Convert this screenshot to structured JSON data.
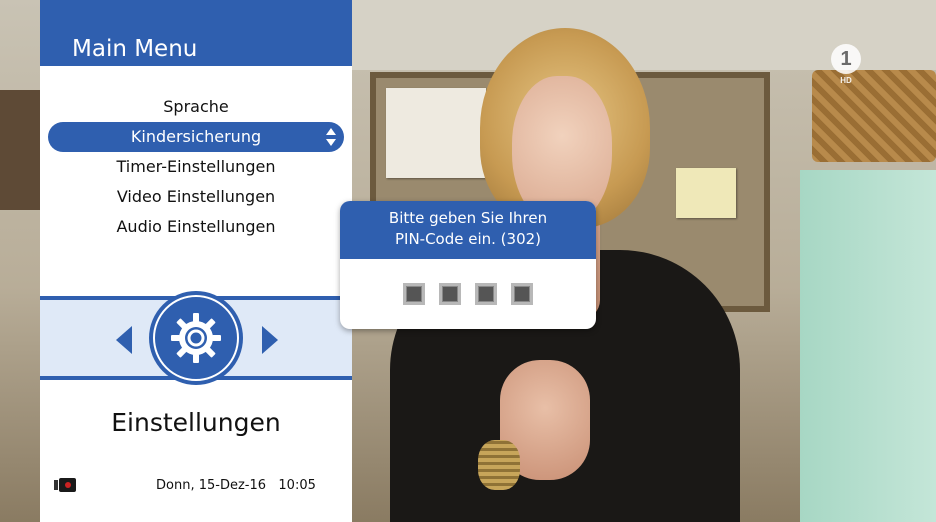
{
  "channel": {
    "logo_text": "1",
    "quality": "HD"
  },
  "menu": {
    "title": "Main Menu",
    "items": [
      {
        "label": "Sprache",
        "selected": false
      },
      {
        "label": "Kindersicherung",
        "selected": true
      },
      {
        "label": "Timer-Einstellungen",
        "selected": false
      },
      {
        "label": "Video Einstellungen",
        "selected": false
      },
      {
        "label": "Audio Einstellungen",
        "selected": false
      }
    ],
    "category": "Einstellungen",
    "category_icon": "gear-icon"
  },
  "status": {
    "datetime": "Donn, 15-Dez-16   10:05",
    "recording_icon": "recording-icon"
  },
  "pin_dialog": {
    "line1": "Bitte geben Sie Ihren",
    "line2": "PIN-Code ein. (302)",
    "digit_count": 4
  },
  "colors": {
    "accent": "#2f5faf",
    "panel_bg": "#ffffff",
    "carousel_band": "#dfe9f7"
  }
}
